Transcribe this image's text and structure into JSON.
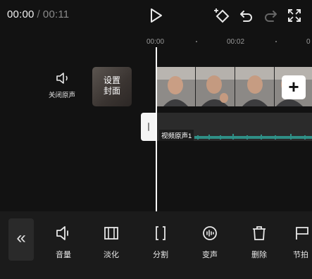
{
  "topbar": {
    "current_time": "00:00",
    "separator": "/",
    "total_time": "00:11"
  },
  "ruler": {
    "labels": [
      "00:00",
      "00:02"
    ]
  },
  "track": {
    "mute_label": "关闭原声",
    "cover_label_line1": "设置",
    "cover_label_line2": "封面",
    "audio_clip_label": "视频原声1"
  },
  "toolbar": {
    "items": [
      {
        "label": "音量",
        "icon": "volume-icon"
      },
      {
        "label": "淡化",
        "icon": "fade-icon"
      },
      {
        "label": "分割",
        "icon": "split-icon"
      },
      {
        "label": "变声",
        "icon": "voice-change-icon"
      },
      {
        "label": "删除",
        "icon": "delete-icon"
      },
      {
        "label": "节拍",
        "icon": "beat-icon"
      }
    ]
  },
  "colors": {
    "background": "#121212",
    "toolbar": "#1b1b1b",
    "audio_wave": "#2f8f86"
  }
}
